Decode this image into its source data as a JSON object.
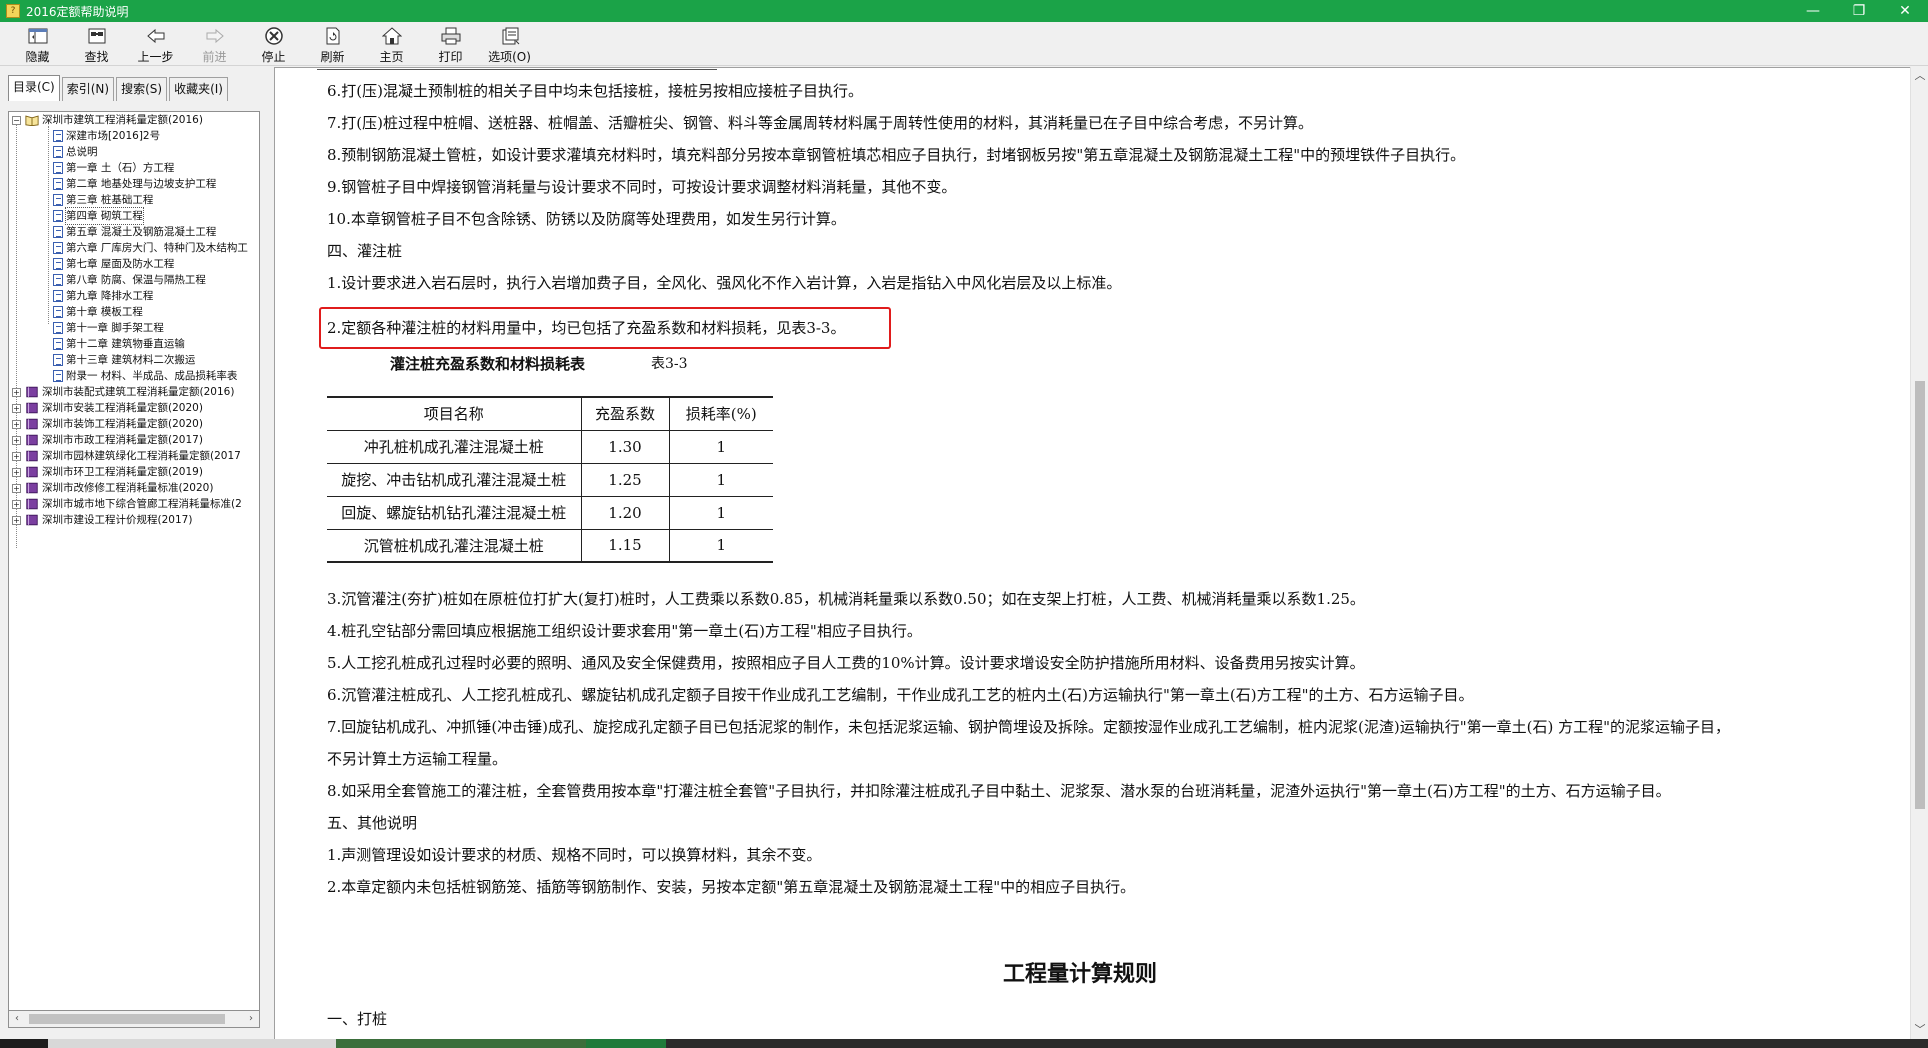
{
  "window": {
    "title": "2016定额帮助说明",
    "controls": {
      "minimize": "—",
      "maximize": "❐",
      "close": "✕"
    }
  },
  "toolbar": {
    "items": [
      {
        "label": "隐藏",
        "icon": "hide-pane-icon",
        "enabled": true
      },
      {
        "label": "查找",
        "icon": "find-icon",
        "enabled": true
      },
      {
        "label": "上一步",
        "icon": "back-arrow-icon",
        "enabled": true
      },
      {
        "label": "前进",
        "icon": "forward-arrow-icon",
        "enabled": false
      },
      {
        "label": "停止",
        "icon": "stop-icon",
        "enabled": true
      },
      {
        "label": "刷新",
        "icon": "refresh-icon",
        "enabled": true
      },
      {
        "label": "主页",
        "icon": "home-icon",
        "enabled": true
      },
      {
        "label": "打印",
        "icon": "print-icon",
        "enabled": true
      },
      {
        "label": "选项(O)",
        "icon": "options-icon",
        "enabled": true
      }
    ]
  },
  "left_pane": {
    "tabs": [
      {
        "label": "目录(C)",
        "active": true
      },
      {
        "label": "索引(N)",
        "active": false
      },
      {
        "label": "搜索(S)",
        "active": false
      },
      {
        "label": "收藏夹(I)",
        "active": false
      }
    ],
    "tree": {
      "root": {
        "label": "深圳市建筑工程消耗量定额(2016)",
        "expanded": true
      },
      "children": [
        "深建市场[2016]2号",
        "总说明",
        "第一章 土（石）方工程",
        "第二章 地基处理与边坡支护工程",
        "第三章 桩基础工程",
        "第四章 砌筑工程",
        "第五章 混凝土及钢筋混凝土工程",
        "第六章 厂库房大门、特种门及木结构工",
        "第七章 屋面及防水工程",
        "第八章 防腐、保温与隔热工程",
        "第九章 降排水工程",
        "第十章 模板工程",
        "第十一章 脚手架工程",
        "第十二章 建筑物垂直运输",
        "第十三章 建筑材料二次搬运",
        "附录一 材料、半成品、成品损耗率表"
      ],
      "selected": "第四章 砌筑工程",
      "siblings": [
        "深圳市装配式建筑工程消耗量定额(2016)",
        "深圳市安装工程消耗量定额(2020)",
        "深圳市装饰工程消耗量定额(2020)",
        "深圳市市政工程消耗量定额(2017)",
        "深圳市园林建筑绿化工程消耗量定额(2017",
        "深圳市环卫工程消耗量定额(2019)",
        "深圳市改修修工程消耗量标准(2020)",
        "深圳市城市地下综合管廊工程消耗量标准(2",
        "深圳市建设工程计价规程(2017)"
      ]
    },
    "hscroll": {
      "left": "‹",
      "right": "›"
    }
  },
  "content": {
    "paragraphs_top": [
      "6.打(压)混凝土预制桩的相关子目中均未包括接桩，接桩另按相应接桩子目执行。",
      "7.打(压)桩过程中桩帽、送桩器、桩帽盖、活瓣桩尖、钢管、料斗等金属周转材料属于周转性使用的材料，其消耗量已在子目中综合考虑，不另计算。",
      "8.预制钢筋混凝土管桩，如设计要求灌填充材料时，填充料部分另按本章钢管桩填芯相应子目执行，封堵钢板另按\"第五章混凝土及钢筋混凝土工程\"中的预埋铁件子目执行。",
      "9.钢管桩子目中焊接钢管消耗量与设计要求不同时，可按设计要求调整材料消耗量，其他不变。",
      "10.本章钢管桩子目不包含除锈、防锈以及防腐等处理费用，如发生另行计算。",
      "四、灌注桩",
      "1.设计要求进入岩石层时，执行入岩增加费子目，全风化、强风化不作入岩计算，入岩是指钻入中风化岩层及以上标准。",
      "2.定额各种灌注桩的材料用量中，均已包括了充盈系数和材料损耗，见表3-3。"
    ],
    "table": {
      "title": "灌注桩充盈系数和材料损耗表",
      "number": "表3-3",
      "headers": [
        "项目名称",
        "充盈系数",
        "损耗率(%)"
      ],
      "rows": [
        [
          "冲孔桩机成孔灌注混凝土桩",
          "1.30",
          "1"
        ],
        [
          "旋挖、冲击钻机成孔灌注混凝土桩",
          "1.25",
          "1"
        ],
        [
          "回旋、螺旋钻机钻孔灌注混凝土桩",
          "1.20",
          "1"
        ],
        [
          "沉管桩机成孔灌注混凝土桩",
          "1.15",
          "1"
        ]
      ]
    },
    "paragraphs_bottom": [
      "3.沉管灌注(夯扩)桩如在原桩位打扩大(复打)桩时，人工费乘以系数0.85，机械消耗量乘以系数0.50；如在支架上打桩，人工费、机械消耗量乘以系数1.25。",
      "4.桩孔空钻部分需回填应根据施工组织设计要求套用\"第一章土(石)方工程\"相应子目执行。",
      "5.人工挖孔桩成孔过程时必要的照明、通风及安全保健费用，按照相应子目人工费的10%计算。设计要求增设安全防护措施所用材料、设备费用另按实计算。",
      "6.沉管灌注桩成孔、人工挖孔桩成孔、螺旋钻机成孔定额子目按干作业成孔工艺编制，干作业成孔工艺的桩内土(石)方运输执行\"第一章土(石)方工程\"的土方、石方运输子目。",
      "7.回旋钻机成孔、冲抓锤(冲击锤)成孔、旋挖成孔定额子目已包括泥浆的制作，未包括泥浆运输、钢护筒埋设及拆除。定额按湿作业成孔工艺编制，桩内泥浆(泥渣)运输执行\"第一章土(石) 方工程\"的泥浆运输子目，",
      "不另计算土方运输工程量。",
      "8.如采用全套管施工的灌注桩，全套管费用按本章\"打灌注桩全套管\"子目执行，并扣除灌注桩成孔子目中黏土、泥浆泵、潜水泵的台班消耗量，泥渣外运执行\"第一章土(石)方工程\"的土方、石方运输子目。",
      "五、其他说明",
      "1.声测管理设如设计要求的材质、规格不同时，可以换算材料，其余不变。",
      "2.本章定额内未包括桩钢筋笼、插筋等钢筋制作、安装，另按本定额\"第五章混凝土及钢筋混凝土工程\"中的相应子目执行。"
    ],
    "heading": "工程量计算规则",
    "last_line": "一、打桩",
    "highlight_color": "#e01c1c"
  },
  "vscroll": {
    "up": "︿",
    "down": "﹀"
  }
}
